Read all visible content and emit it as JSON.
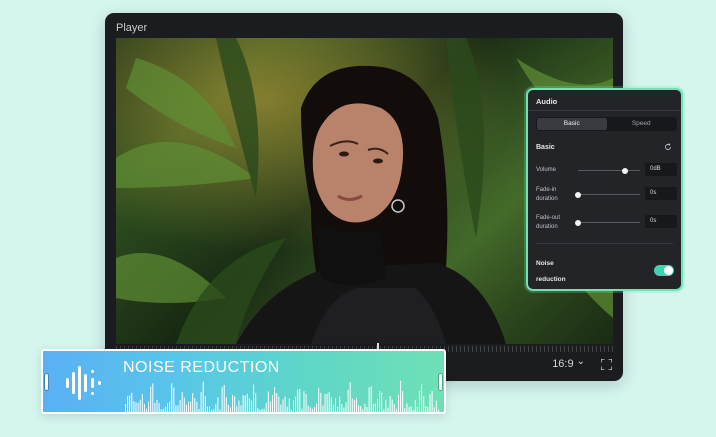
{
  "player": {
    "title": "Player",
    "aspect_ratio": "16:9",
    "aspect_chevron": "⌄"
  },
  "audio_panel": {
    "title": "Audio",
    "tabs": [
      {
        "label": "Basic",
        "active": true
      },
      {
        "label": "Speed",
        "active": false
      }
    ],
    "section_title": "Basic",
    "controls": [
      {
        "label": "Volume",
        "value": "0dB",
        "level": 0.75
      },
      {
        "label": "Fade-in duration",
        "value": "0s",
        "level": 0.0
      },
      {
        "label": "Fade-out duration",
        "value": "0s",
        "level": 0.0
      }
    ],
    "noise_reduction": {
      "label": "Noise reduction",
      "enabled": true
    }
  },
  "banner": {
    "title": "NOISE REDUCTION"
  },
  "colors": {
    "accent": "#6fe3b4",
    "toggle_on": "#3fd3b0",
    "background": "#d5f5ef"
  }
}
